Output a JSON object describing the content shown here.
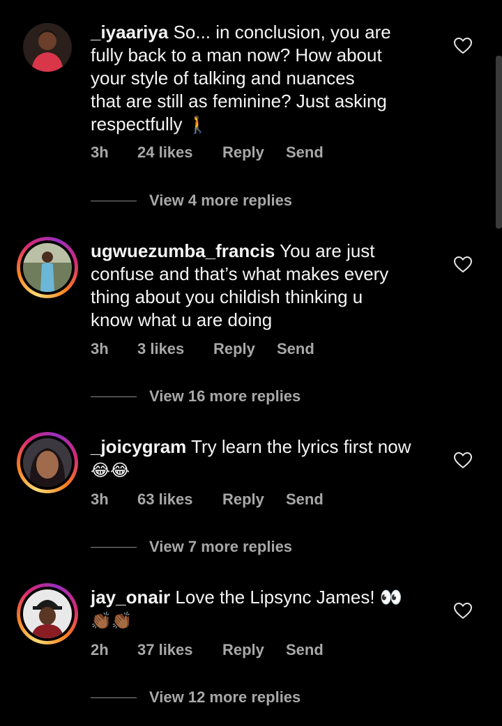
{
  "comments": [
    {
      "username": "_iyaariya",
      "lines": [
        "So... in conclusion,  you are",
        "fully back to a man now? How about",
        "your style of talking and nuances",
        "that are still as feminine? Just asking",
        "respectfully"
      ],
      "emoji": "🚶",
      "time": "3h",
      "likes": "24 likes",
      "reply": "Reply",
      "send": "Send",
      "view_replies": "View 4 more replies"
    },
    {
      "username": "ugwuezumba_francis",
      "lines": [
        "You are just",
        "confuse and that’s what makes every",
        "thing about you childish thinking u",
        "know what u are doing"
      ],
      "time": "3h",
      "likes": "3 likes",
      "reply": "Reply",
      "send": "Send",
      "view_replies": "View 16 more replies"
    },
    {
      "username": "_joicygram",
      "lines": [
        "Try learn the lyrics first now"
      ],
      "emoji": "😂😂",
      "time": "3h",
      "likes": "63 likes",
      "reply": "Reply",
      "send": "Send",
      "view_replies": "View 7 more replies"
    },
    {
      "username": "jay_onair",
      "lines": [
        "Love the Lipsync James! 👀"
      ],
      "emoji": "👏🏾👏🏾",
      "time": "2h",
      "likes": "37 likes",
      "reply": "Reply",
      "send": "Send",
      "view_replies": "View 12 more replies"
    }
  ],
  "icons": {
    "like": "heart-outline-icon"
  },
  "colors": {
    "background": "#000000",
    "text": "#f5f5f5",
    "secondary": "#a8a8a8"
  }
}
